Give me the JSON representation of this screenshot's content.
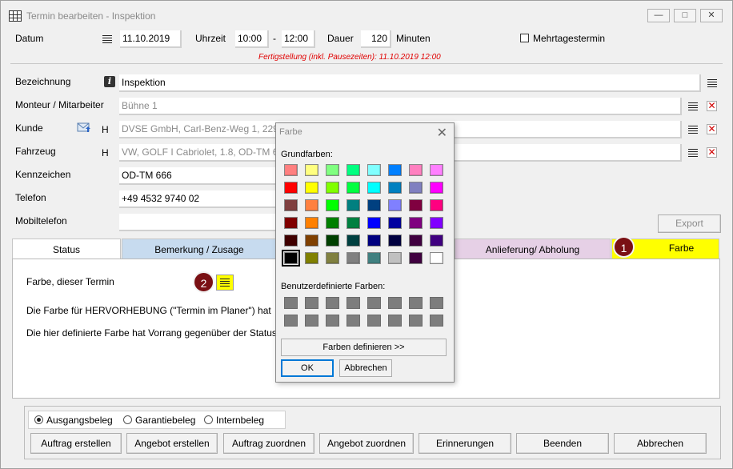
{
  "window": {
    "title": "Termin bearbeiten - Inspektion"
  },
  "header": {
    "datum_label": "Datum",
    "datum_value": "11.10.2019",
    "uhrzeit_label": "Uhrzeit",
    "uhrzeit_from": "10:00",
    "uhrzeit_sep": "-",
    "uhrzeit_to": "12:00",
    "dauer_label": "Dauer",
    "dauer_value": "120",
    "dauer_unit": "Minuten",
    "mehrtage_label": "Mehrtagestermin",
    "fertig_note": "Fertigstellung (inkl. Pausezeiten): 11.10.2019 12:00"
  },
  "form": {
    "bezeichnung_label": "Bezeichnung",
    "bezeichnung_value": "Inspektion",
    "monteur_label": "Monteur / Mitarbeiter",
    "monteur_value": "Bühne 1",
    "kunde_label": "Kunde",
    "kunde_h": "H",
    "kunde_value": "DVSE GmbH, Carl-Benz-Weg 1, 229",
    "fahrzeug_label": "Fahrzeug",
    "fahrzeug_h": "H",
    "fahrzeug_value": "VW, GOLF I Cabriolet, 1.8, OD-TM 66",
    "kennzeichen_label": "Kennzeichen",
    "kennzeichen_value": "OD-TM 666",
    "telefon_label": "Telefon",
    "telefon_value": "+49 4532 9740 02",
    "mobil_label": "Mobiltelefon",
    "mobil_value": "",
    "export_label": "Export"
  },
  "tabs": [
    {
      "label": "Status"
    },
    {
      "label": "Bemerkung / Zusage"
    },
    {
      "label": "Anlieferung/ Abholung"
    },
    {
      "label": "Farbe"
    }
  ],
  "panel": {
    "farbe_label": "Farbe, dieser Termin",
    "line1": "Die Farbe für HERVORHEBUNG (\"Termin im Planer\") hat",
    "line2": "Die hier definierte Farbe hat Vorrang gegenüber der Status"
  },
  "badges": [
    "1",
    "2"
  ],
  "bottom": {
    "radios": [
      {
        "label": "Ausgangsbeleg",
        "checked": true
      },
      {
        "label": "Garantiebeleg",
        "checked": false
      },
      {
        "label": "Internbeleg",
        "checked": false
      }
    ],
    "buttons": [
      "Auftrag erstellen",
      "Angebot erstellen",
      "Auftrag zuordnen",
      "Angebot zuordnen",
      "Erinnerungen",
      "Beenden",
      "Abbrechen"
    ]
  },
  "dialog": {
    "title": "Farbe",
    "basic_label": "Grundfarben:",
    "custom_label": "Benutzerdefinierte Farben:",
    "define_button": "Farben definieren >>",
    "ok_button": "OK",
    "cancel_button": "Abbrechen",
    "basic_colors": [
      "#ff8080",
      "#ffff80",
      "#80ff80",
      "#00ff80",
      "#80ffff",
      "#0080ff",
      "#ff80c0",
      "#ff80ff",
      "#ff0000",
      "#ffff00",
      "#80ff00",
      "#00ff40",
      "#00ffff",
      "#0080c0",
      "#8080c0",
      "#ff00ff",
      "#804040",
      "#ff8040",
      "#00ff00",
      "#008080",
      "#004080",
      "#8080ff",
      "#800040",
      "#ff0080",
      "#800000",
      "#ff8000",
      "#008000",
      "#008040",
      "#0000ff",
      "#0000a0",
      "#800080",
      "#8000ff",
      "#400000",
      "#804000",
      "#004000",
      "#004040",
      "#000080",
      "#000040",
      "#400040",
      "#400080",
      "#000000",
      "#808000",
      "#808040",
      "#808080",
      "#408080",
      "#c0c0c0",
      "#400040",
      "#ffffff"
    ],
    "selected_index": 40
  },
  "colors": {
    "tab_farbe": "#ffff00",
    "tab_bemerkung": "#c7dbef",
    "tab_anlieferung": "#e6d0e6",
    "badge": "#7a1014",
    "note_red": "#e00000"
  }
}
